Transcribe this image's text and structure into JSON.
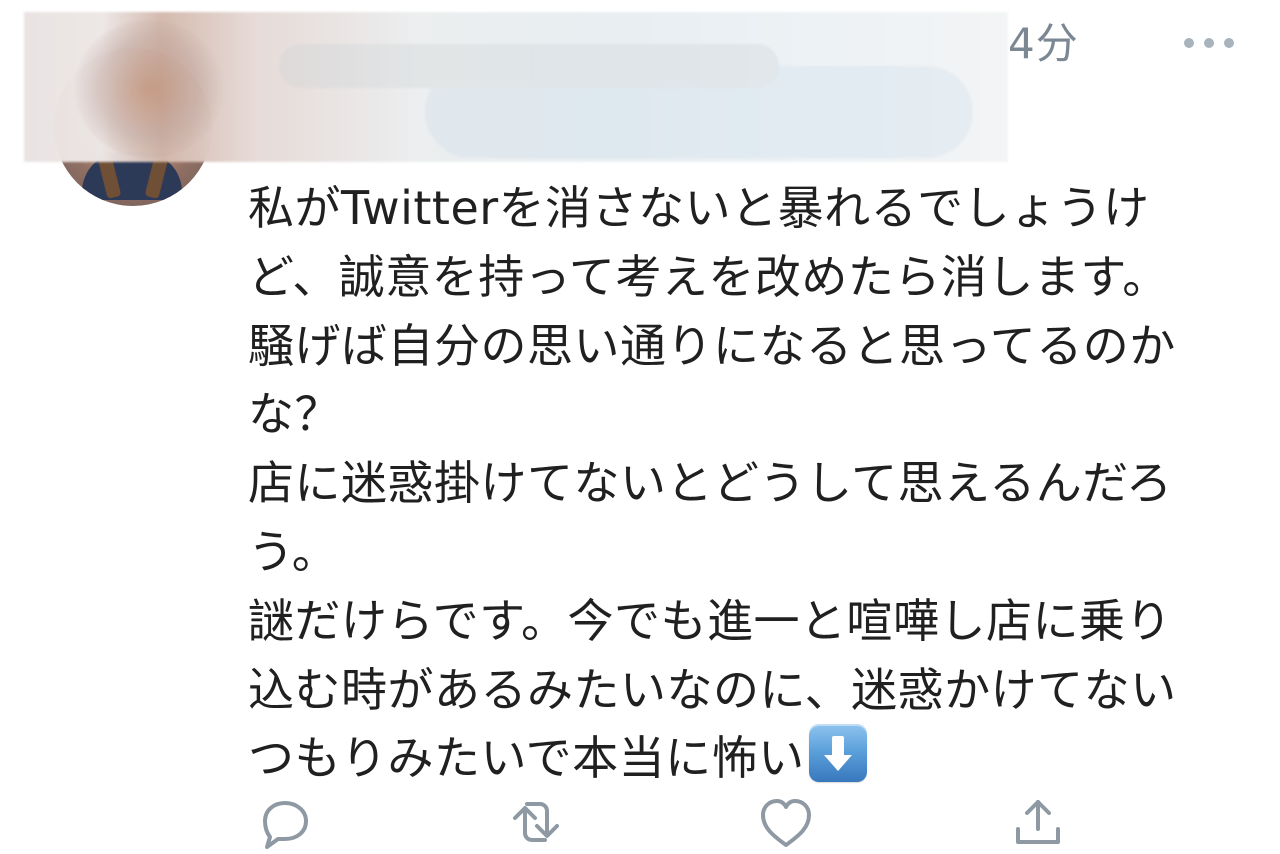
{
  "tweet": {
    "timestamp": "4分",
    "lines": [
      "私がTwitterを消さないと暴れるでしょうけ",
      "ど、誠意を持って考えを改めたら消します。",
      "騒げば自分の思い通りになると思ってるのか",
      "な？",
      "店に迷惑掛けてないとどうして思えるんだろ",
      "う。",
      "謎だけらです。今でも進一と喧嘩し店に乗り",
      "込む時があるみたいなのに、迷惑かけてない",
      "つもりみたいで本当に怖い"
    ],
    "emoji": "down-arrow-icon"
  },
  "actions": {
    "reply_icon": "reply-icon",
    "retweet_icon": "retweet-icon",
    "like_icon": "heart-icon",
    "share_icon": "share-icon"
  },
  "colors": {
    "text": "#202020",
    "muted": "#7b8792",
    "icons": "#8e99a3",
    "emoji_blue": "#4f8fd1"
  }
}
